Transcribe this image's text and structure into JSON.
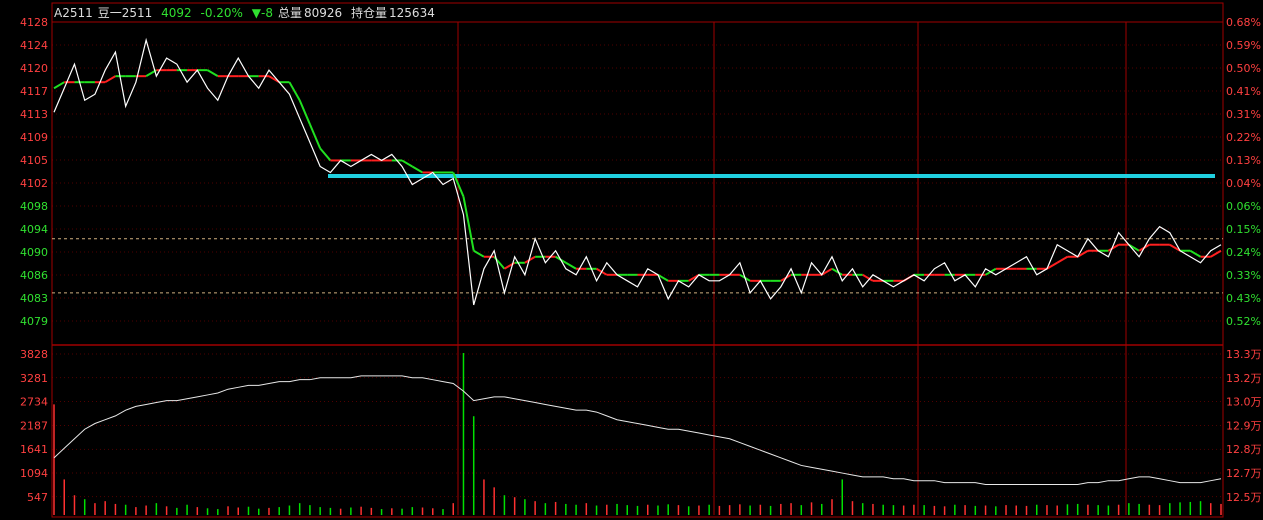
{
  "header": {
    "code": "A2511",
    "name": "豆一2511",
    "price": "4092",
    "change_pct": "-0.20%",
    "change": "▼-8",
    "total_volume_label": "总量",
    "total_volume": "80926",
    "open_interest_label": "持仓量",
    "open_interest": "125634"
  },
  "colors": {
    "background": "#000000",
    "frame": "#a00000",
    "up": "#ff3030",
    "down": "#00e000",
    "price_line": "#ffffff",
    "avg_up": "#ff2020",
    "avg_down": "#20e020",
    "support_line": "#20d0e0",
    "dashed_ref": "#d0b080"
  },
  "chart_data": [
    {
      "type": "line",
      "title": "",
      "y_ticks_left": [
        "4128",
        "4124",
        "4120",
        "4117",
        "4113",
        "4109",
        "4105",
        "4102",
        "4098",
        "4094",
        "4090",
        "4086",
        "4083",
        "4079"
      ],
      "y_ticks_right": [
        "0.68%",
        "0.59%",
        "0.50%",
        "0.41%",
        "0.31%",
        "0.22%",
        "0.13%",
        "0.04%",
        "0.06%",
        "0.15%",
        "0.24%",
        "0.33%",
        "0.43%",
        "0.52%"
      ],
      "ylim": [
        4077,
        4129
      ],
      "prev_reference": 4100.5,
      "dashed_levels": [
        4093,
        4084
      ],
      "support_level": 4103,
      "series": [
        {
          "values": [
            4114,
            4118,
            4122,
            4116,
            4117,
            4121,
            4124,
            4115,
            4119,
            4126,
            4120,
            4123,
            4122,
            4119,
            4121,
            4118,
            4116,
            4120,
            4123,
            4120,
            4118,
            4121,
            4119,
            4117,
            4113,
            4109,
            4105,
            4104,
            4106,
            4105,
            4106,
            4107,
            4106,
            4107,
            4105,
            4102,
            4103,
            4104,
            4102,
            4103,
            4097,
            4082,
            4088,
            4091,
            4084,
            4090,
            4087,
            4093,
            4089,
            4091,
            4088,
            4087,
            4090,
            4086,
            4089,
            4087,
            4086,
            4085,
            4088,
            4087,
            4083,
            4086,
            4085,
            4087,
            4086,
            4086,
            4087,
            4089,
            4084,
            4086,
            4083,
            4085,
            4088,
            4084,
            4089,
            4087,
            4090,
            4086,
            4088,
            4085,
            4087,
            4086,
            4085,
            4086,
            4087,
            4086,
            4088,
            4089,
            4086,
            4087,
            4085,
            4088,
            4087,
            4088,
            4089,
            4090,
            4087,
            4088,
            4092,
            4091,
            4090,
            4093,
            4091,
            4090,
            4094,
            4092,
            4090,
            4093,
            4095,
            4094,
            4091,
            4090,
            4089,
            4091,
            4092
          ]
        },
        {
          "values": [
            4118,
            4119,
            4119,
            4119,
            4119,
            4119,
            4120,
            4120,
            4120,
            4120,
            4121,
            4121,
            4121,
            4121,
            4121,
            4121,
            4120,
            4120,
            4120,
            4120,
            4120,
            4120,
            4119,
            4119,
            4116,
            4112,
            4108,
            4106,
            4106,
            4106,
            4106,
            4106,
            4106,
            4106,
            4106,
            4105,
            4104,
            4104,
            4104,
            4104,
            4100,
            4091,
            4090,
            4090,
            4088,
            4089,
            4089,
            4090,
            4090,
            4090,
            4089,
            4088,
            4088,
            4088,
            4087,
            4087,
            4087,
            4087,
            4087,
            4087,
            4086,
            4086,
            4086,
            4087,
            4087,
            4087,
            4087,
            4087,
            4086,
            4086,
            4086,
            4086,
            4087,
            4087,
            4087,
            4087,
            4088,
            4087,
            4087,
            4087,
            4086,
            4086,
            4086,
            4086,
            4087,
            4087,
            4087,
            4087,
            4087,
            4087,
            4087,
            4087,
            4088,
            4088,
            4088,
            4088,
            4088,
            4088,
            4089,
            4090,
            4090,
            4091,
            4091,
            4091,
            4092,
            4092,
            4091,
            4092,
            4092,
            4092,
            4091,
            4091,
            4090,
            4090,
            4091
          ]
        }
      ]
    },
    {
      "type": "bar",
      "title": "",
      "y_ticks_left": [
        "3828",
        "3281",
        "2734",
        "2187",
        "1641",
        "1094",
        "547"
      ],
      "y_ticks_right": [
        "13.3万",
        "13.2万",
        "13.0万",
        "12.9万",
        "12.8万",
        "12.7万",
        "12.5万"
      ],
      "ylim": [
        0,
        4100
      ],
      "volume": [
        2800,
        900,
        500,
        400,
        300,
        350,
        280,
        260,
        200,
        240,
        300,
        220,
        180,
        260,
        200,
        170,
        150,
        220,
        190,
        210,
        160,
        180,
        200,
        240,
        300,
        250,
        200,
        180,
        160,
        190,
        210,
        180,
        150,
        170,
        160,
        200,
        190,
        170,
        150,
        300,
        4100,
        2500,
        900,
        700,
        500,
        450,
        400,
        350,
        300,
        330,
        280,
        260,
        300,
        240,
        260,
        280,
        250,
        230,
        260,
        240,
        270,
        250,
        220,
        240,
        260,
        230,
        250,
        270,
        240,
        260,
        230,
        280,
        300,
        250,
        320,
        280,
        400,
        900,
        350,
        300,
        280,
        260,
        250,
        240,
        260,
        250,
        230,
        220,
        260,
        250,
        230,
        240,
        220,
        250,
        240,
        230,
        260,
        250,
        240,
        270,
        280,
        260,
        250,
        240,
        260,
        300,
        280,
        260,
        250,
        300,
        320,
        330,
        350,
        300,
        280
      ],
      "open_interest": [
        12.8,
        12.85,
        12.9,
        12.95,
        12.98,
        13.0,
        13.02,
        13.05,
        13.07,
        13.08,
        13.09,
        13.1,
        13.1,
        13.11,
        13.12,
        13.13,
        13.14,
        13.16,
        13.17,
        13.18,
        13.18,
        13.19,
        13.2,
        13.2,
        13.21,
        13.21,
        13.22,
        13.22,
        13.22,
        13.22,
        13.23,
        13.23,
        13.23,
        13.23,
        13.23,
        13.22,
        13.22,
        13.21,
        13.2,
        13.19,
        13.15,
        13.1,
        13.11,
        13.12,
        13.12,
        13.11,
        13.1,
        13.09,
        13.08,
        13.07,
        13.06,
        13.05,
        13.05,
        13.04,
        13.02,
        13.0,
        12.99,
        12.98,
        12.97,
        12.96,
        12.95,
        12.95,
        12.94,
        12.93,
        12.92,
        12.91,
        12.9,
        12.88,
        12.86,
        12.84,
        12.82,
        12.8,
        12.78,
        12.76,
        12.75,
        12.74,
        12.73,
        12.72,
        12.71,
        12.7,
        12.7,
        12.7,
        12.69,
        12.69,
        12.68,
        12.68,
        12.68,
        12.67,
        12.67,
        12.67,
        12.67,
        12.66,
        12.66,
        12.66,
        12.66,
        12.66,
        12.66,
        12.66,
        12.66,
        12.66,
        12.66,
        12.67,
        12.67,
        12.68,
        12.68,
        12.69,
        12.7,
        12.7,
        12.69,
        12.68,
        12.67,
        12.67,
        12.67,
        12.68,
        12.69
      ],
      "oi_range": [
        12.5,
        13.35
      ]
    }
  ]
}
